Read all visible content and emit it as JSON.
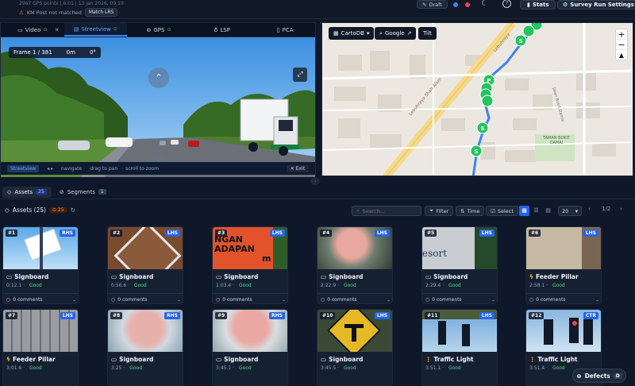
{
  "header": {
    "meta_line": "2967 GPS points | 6:01 | 13 Jan 2026, 09:19",
    "km_post_status": "KM Post not matched",
    "match_label": "Match LRS",
    "draft_label": "Draft",
    "stats_label": "Stats",
    "settings_label": "Survey Run Settings"
  },
  "video": {
    "tabs": [
      {
        "label": "Video"
      },
      {
        "label": "Streetview"
      },
      {
        "label": "GPS"
      },
      {
        "label": "LSP"
      },
      {
        "label": "PCA"
      }
    ],
    "frame_label": "Frame 1 / 381",
    "distance": "0m",
    "heading": "0°",
    "hints": {
      "streetview": "Streetview",
      "navigate": "navigate",
      "drag": "drag to pan",
      "scroll": "scroll to zoom",
      "exit": "Exit"
    }
  },
  "map": {
    "basemap": "CartoDB",
    "google": "Google",
    "tilt": "Tilt",
    "zoom_in": "+",
    "zoom_out": "−",
    "labels": [
      "Lebuhraya Shah Alam",
      "TAMAN BUKIT DAMAI",
      "Lebuhraya",
      "Jalan Bukit Damai"
    ]
  },
  "bottom": {
    "tabs": [
      {
        "label": "Assets",
        "count": "25"
      },
      {
        "label": "Segments",
        "count": "1"
      }
    ],
    "assets_title": "Assets (25)",
    "warning_count": "25",
    "search_placeholder": "Search...",
    "filter_label": "Filter",
    "time_label": "Time",
    "select_label": "Select",
    "per_page": "20",
    "page_indicator": "1/2"
  },
  "assets": [
    {
      "num": "#1",
      "side": "RHS",
      "type": "Signboard",
      "time": "0:12.1",
      "condition": "Good",
      "comments": "0 comments"
    },
    {
      "num": "#2",
      "side": "LHS",
      "type": "Signboard",
      "time": "0:56.6",
      "condition": "Good",
      "comments": "0 comments"
    },
    {
      "num": "#3",
      "side": "LHS",
      "type": "Signboard",
      "time": "1:03.4",
      "condition": "Good",
      "comments": "0 comments"
    },
    {
      "num": "#4",
      "side": "LHS",
      "type": "Signboard",
      "time": "2:22.9",
      "condition": "Good",
      "comments": "0 comments"
    },
    {
      "num": "#5",
      "side": "LHS",
      "type": "Signboard",
      "time": "2:29.4",
      "condition": "Good",
      "comments": "0 comments"
    },
    {
      "num": "#6",
      "side": "LHS",
      "type": "Feeder Pillar",
      "time": "2:58.1",
      "condition": "Good",
      "comments": "0 comments"
    },
    {
      "num": "#7",
      "side": "LHS",
      "type": "Feeder Pillar",
      "time": "3:01.6",
      "condition": "Good",
      "comments": ""
    },
    {
      "num": "#8",
      "side": "RHS",
      "type": "Signboard",
      "time": "3:25",
      "condition": "Good",
      "comments": ""
    },
    {
      "num": "#9",
      "side": "RHS",
      "type": "Signboard",
      "time": "3:45.1",
      "condition": "Good",
      "comments": ""
    },
    {
      "num": "#10",
      "side": "LHS",
      "type": "Signboard",
      "time": "3:45.5",
      "condition": "Good",
      "comments": ""
    },
    {
      "num": "#11",
      "side": "LHS",
      "type": "Traffic Light",
      "time": "3:51.1",
      "condition": "Good",
      "comments": ""
    },
    {
      "num": "#12",
      "side": "CTR",
      "type": "Traffic Light",
      "time": "3:51.4",
      "condition": "Good",
      "comments": ""
    }
  ],
  "sign_text": {
    "line1": "NGAN",
    "line2": "ADAPAN",
    "line3": "m",
    "sign4": "esort"
  },
  "defects": {
    "label": "Defects",
    "key": "D"
  }
}
